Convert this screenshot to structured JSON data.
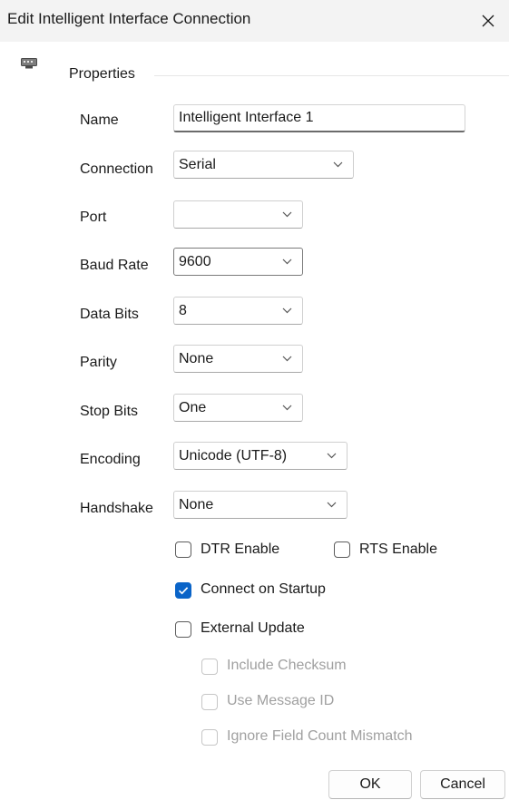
{
  "window": {
    "title": "Edit Intelligent Interface Connection",
    "close_glyph": "✕",
    "app_icon": "cii-device-icon"
  },
  "properties": {
    "group_label": "Properties",
    "name": {
      "label": "Name",
      "value": "Intelligent Interface 1"
    },
    "connection": {
      "label": "Connection",
      "value": "Serial"
    },
    "port": {
      "label": "Port",
      "value": ""
    },
    "baud_rate": {
      "label": "Baud Rate",
      "value": "9600"
    },
    "data_bits": {
      "label": "Data Bits",
      "value": "8"
    },
    "parity": {
      "label": "Parity",
      "value": "None"
    },
    "stop_bits": {
      "label": "Stop Bits",
      "value": "One"
    },
    "encoding": {
      "label": "Encoding",
      "value": "Unicode (UTF-8)"
    },
    "handshake": {
      "label": "Handshake",
      "value": "None"
    }
  },
  "options": {
    "dtr_enable": {
      "label": "DTR Enable",
      "checked": false,
      "enabled": true
    },
    "rts_enable": {
      "label": "RTS Enable",
      "checked": false,
      "enabled": true
    },
    "connect_on_startup": {
      "label": "Connect on Startup",
      "checked": true,
      "enabled": true
    },
    "external_update": {
      "label": "External Update",
      "checked": false,
      "enabled": true
    },
    "include_checksum": {
      "label": "Include Checksum",
      "checked": false,
      "enabled": false
    },
    "use_message_id": {
      "label": "Use Message ID",
      "checked": false,
      "enabled": false
    },
    "ignore_field_count_mismatch": {
      "label": "Ignore Field Count Mismatch",
      "checked": false,
      "enabled": false
    }
  },
  "buttons": {
    "ok": "OK",
    "cancel": "Cancel"
  },
  "colors": {
    "accent": "#0a64c8",
    "titlebar": "#f3f3f3",
    "disabled_text": "#a0a0a0"
  }
}
